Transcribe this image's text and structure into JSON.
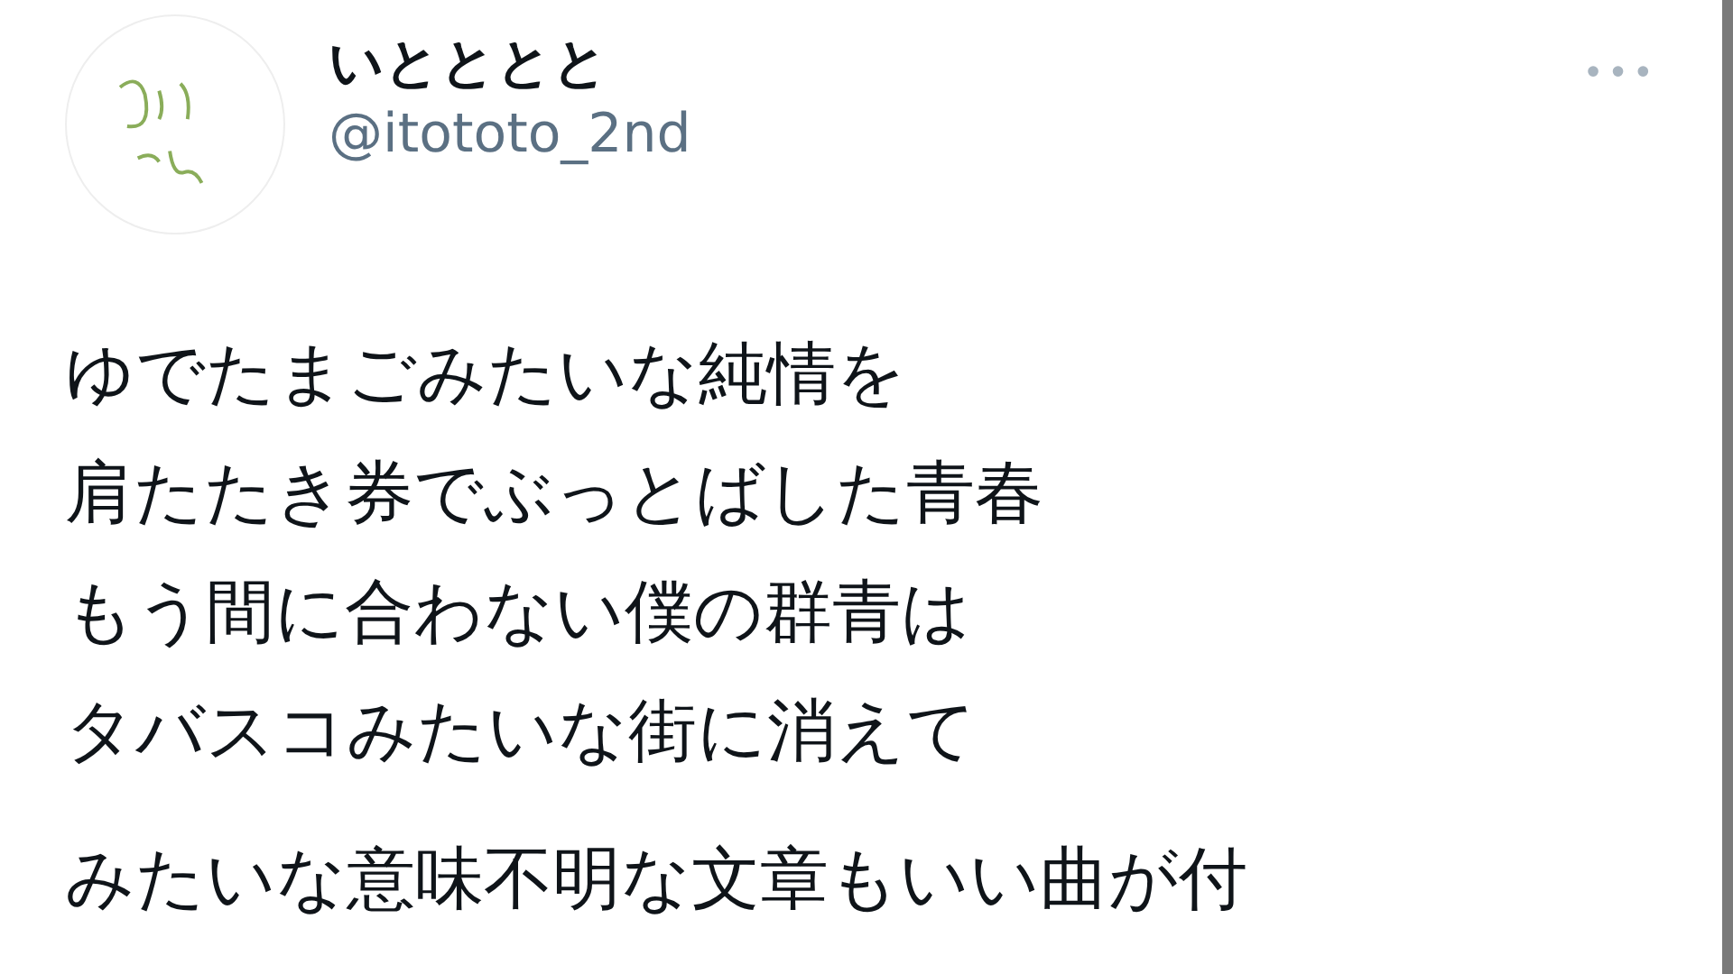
{
  "author": {
    "name": "いとととと",
    "handle": "@itototo_2nd"
  },
  "more_button": {
    "label": "•••"
  },
  "tweet": {
    "lines": [
      "ゆでたまごみたいな純情を",
      "肩たたき券でぶっとばした青春",
      "もう間に合わない僕の群青は",
      "タバスコみたいな街に消えて"
    ],
    "next_paragraph": "みたいな意味不明な文章もいい曲が付"
  }
}
